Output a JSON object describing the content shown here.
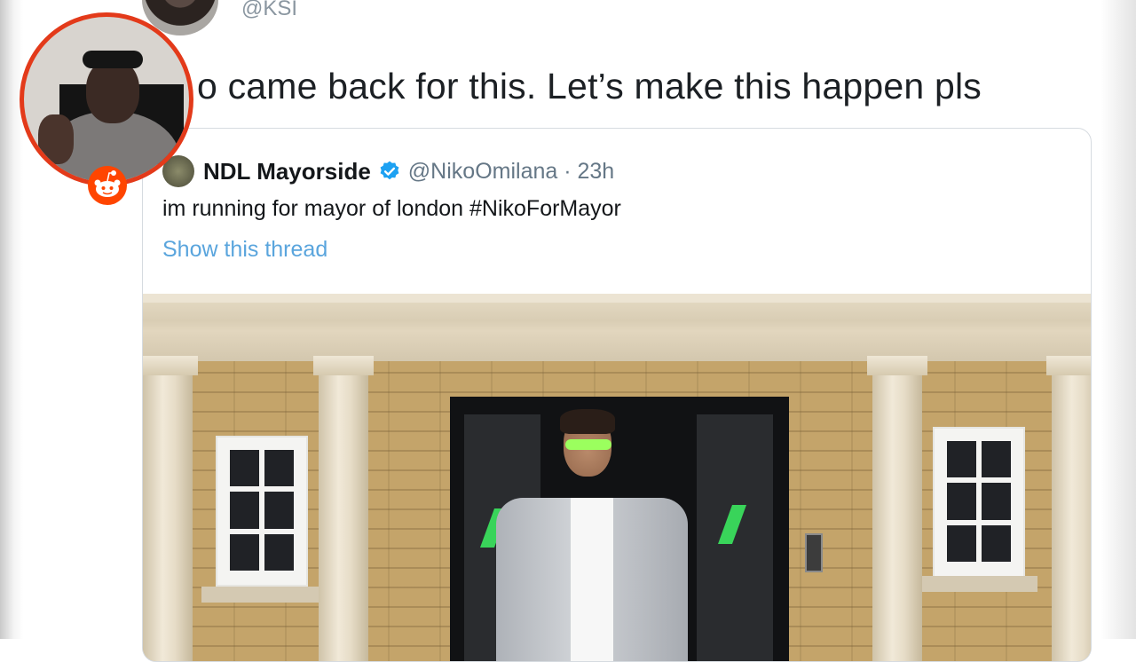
{
  "author": {
    "handle": "@KSI"
  },
  "tweet": {
    "text": "o came back for this. Let’s make this happen pls"
  },
  "quoted_tweet": {
    "display_name": "NDL Mayorside",
    "handle_time": "@NikoOmilana · 23h",
    "body": "im running for mayor of london #NikoForMayor",
    "show_thread": "Show this thread"
  },
  "colors": {
    "link": "#5aa5dd",
    "verified": "#1da1f2",
    "cam_border": "#e33a1a",
    "reddit": "#ff4500"
  },
  "icons": {
    "verified": "verified-badge-icon",
    "reddit": "reddit-icon"
  }
}
